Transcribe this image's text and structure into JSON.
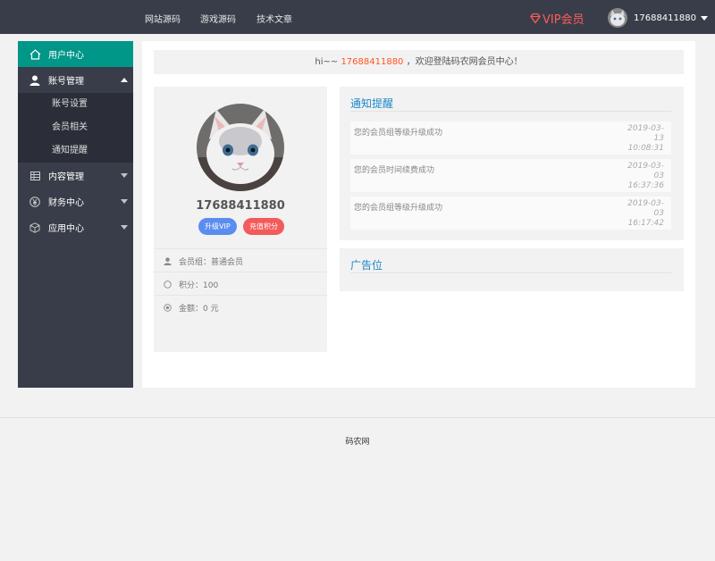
{
  "nav": {
    "links": [
      "网站源码",
      "游戏源码",
      "技术文章"
    ],
    "vip_label": "VIP会员",
    "username": "17688411880"
  },
  "sidebar": {
    "user_center": "用户中心",
    "account_mgmt": "账号管理",
    "account_sub": [
      "账号设置",
      "会员相关",
      "通知提醒"
    ],
    "content_mgmt": "内容管理",
    "finance": "财务中心",
    "apps": "应用中心"
  },
  "welcome": {
    "prefix": "hi~~",
    "username": "17688411880",
    "suffix": "，欢迎登陆码农网会员中心！"
  },
  "profile": {
    "name": "17688411880",
    "upgrade_btn": "升级VIP",
    "charge_btn": "充值积分",
    "group": "会员组：普通会员",
    "points": "积分：100",
    "balance": "金额：0 元"
  },
  "notices": {
    "title": "通知提醒",
    "items": [
      {
        "text": "您的会员组等级升级成功",
        "time": [
          "2019-03-",
          "13",
          "10:08:31"
        ]
      },
      {
        "text": "您的会员时间续费成功",
        "time": [
          "2019-03-",
          "03",
          "16:37:36"
        ]
      },
      {
        "text": "您的会员组等级升级成功",
        "time": [
          "2019-03-",
          "03",
          "16:17:42"
        ]
      }
    ]
  },
  "ad": {
    "title": "广告位"
  },
  "footer": {
    "text": "码农网"
  },
  "colors": {
    "accent": "#009688",
    "vip": "#ff5b5b",
    "link": "#1e88c8",
    "topbar": "#393d49"
  }
}
